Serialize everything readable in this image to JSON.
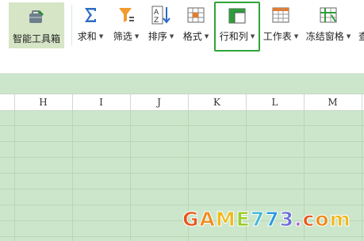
{
  "ribbon": {
    "smart_toolbox": "智能工具箱",
    "sum": "求和",
    "filter": "筛选",
    "sort": "排序",
    "format": "格式",
    "rows_cols": "行和列",
    "worksheet": "工作表",
    "freeze": "冻结窗格",
    "overflow": "查"
  },
  "columns": [
    "H",
    "I",
    "J",
    "K",
    "L",
    "M"
  ],
  "watermark": {
    "text": "GAME773.com",
    "colors": [
      "#e8571a",
      "#f08a1b",
      "#f2b81a",
      "#9ccc2a",
      "#45b8d8",
      "#2b9ae0",
      "#6c6cd8",
      "#b35ad2"
    ]
  },
  "colors": {
    "highlight": "#2ea538",
    "sheet_bg": "#cce6cb"
  }
}
